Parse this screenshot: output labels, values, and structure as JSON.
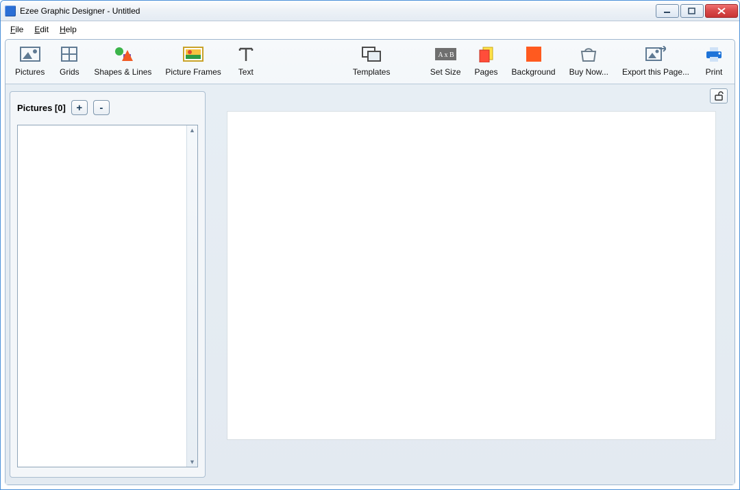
{
  "window": {
    "title": "Ezee Graphic Designer - Untitled"
  },
  "menu": {
    "file": "File",
    "edit": "Edit",
    "help": "Help"
  },
  "toolbar": {
    "pictures": "Pictures",
    "grids": "Grids",
    "shapes": "Shapes & Lines",
    "frames": "Picture Frames",
    "text": "Text",
    "templates": "Templates",
    "setsize": "Set Size",
    "pages": "Pages",
    "background": "Background",
    "buy": "Buy Now...",
    "export": "Export this Page...",
    "print": "Print"
  },
  "panel": {
    "title": "Pictures [0]",
    "add": "+",
    "remove": "-"
  }
}
